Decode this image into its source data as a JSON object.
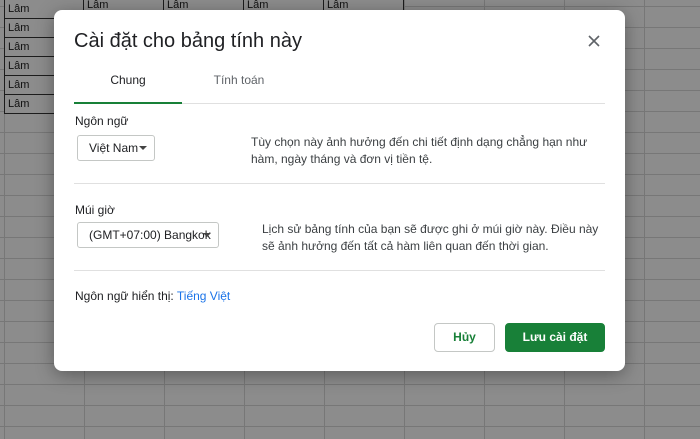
{
  "sheet": {
    "column_a_cells": [
      "Lâm",
      "Lâm",
      "Lâm",
      "Lâm",
      "Lâm",
      "Lâm"
    ],
    "top_row_cells": [
      "Lâm",
      "Lâm",
      "Lâm",
      "Lâm"
    ]
  },
  "dialog": {
    "title": "Cài đặt cho bảng tính này",
    "tabs": [
      {
        "label": "Chung",
        "active": true
      },
      {
        "label": "Tính toán",
        "active": false
      }
    ],
    "locale": {
      "label": "Ngôn ngữ",
      "value": "Việt Nam",
      "description": "Tùy chọn này ảnh hưởng đến chi tiết định dạng chẳng hạn như hàm, ngày tháng và đơn vị tiền tệ."
    },
    "timezone": {
      "label": "Múi giờ",
      "value": "(GMT+07:00) Bangkok",
      "description": "Lịch sử bảng tính của bạn sẽ được ghi ở múi giờ này. Điều này sẽ ảnh hưởng đến tất cả hàm liên quan đến thời gian."
    },
    "display_language": {
      "label": "Ngôn ngữ hiển thị:",
      "link": "Tiếng Việt"
    },
    "buttons": {
      "cancel": "Hủy",
      "save": "Lưu cài đặt"
    },
    "colors": {
      "accent": "#188038",
      "link": "#1a73e8"
    },
    "icons": {
      "close": "close-icon",
      "dropdown": "caret-down-icon"
    }
  }
}
